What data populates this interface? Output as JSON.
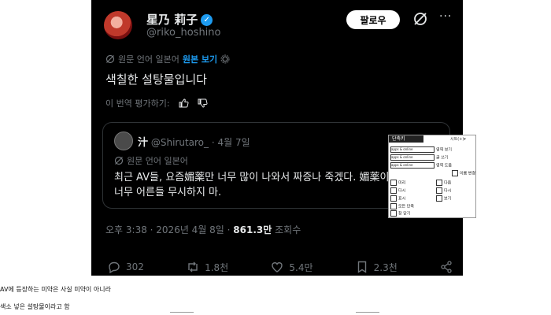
{
  "post": {
    "author_name": "星乃 莉子",
    "handle": "@riko_hoshino",
    "follow_label": "팔로우",
    "more_label": "···",
    "translation_note": "원문 언어 일본어",
    "view_original": "원본 보기",
    "text": "색칠한 설탕물입니다",
    "rate_translation": "이 번역 평가하기:"
  },
  "quote": {
    "author_name": "汁",
    "handle_date": "@Shirutaro_ · 4월 7일",
    "translation_note": "원문 언어 일본어",
    "text": "최근 AV들, 요즘媚薬만 너무 많이 나와서 짜증나 죽겠다. 媚薬이 뭐야 이게. 너무 어른들 무시하지 마."
  },
  "meta": {
    "time_date": "오후 3:38 · 2026년 4월 8일 · ",
    "views_count": "861.3만",
    "views_label": " 조회수"
  },
  "actions": {
    "replies": "302",
    "reposts": "1.8천",
    "likes": "5.4만",
    "bookmarks": "2.3천"
  },
  "context_menu": {
    "header": "단축키",
    "header_right": "시트(+)▾",
    "items": [
      "apps & online",
      "apps & online",
      "apps & online",
      "",
      "",
      "",
      "",
      "",
      "",
      ""
    ],
    "labels": [
      "영역 보기",
      "글 쓰기",
      "영역 도움",
      "",
      "미리",
      "다시",
      "표시",
      "모든 단축",
      "창 닫기",
      ""
    ],
    "right_labels": [
      "이름 변경",
      "",
      "",
      "",
      "다음",
      "다시",
      "보기",
      "",
      "",
      ""
    ]
  },
  "captions": {
    "line1": "AV에 등장하는 미약은 사실 미약이 아니라",
    "line2": "색소 넣은 설탕물이라고 함"
  }
}
